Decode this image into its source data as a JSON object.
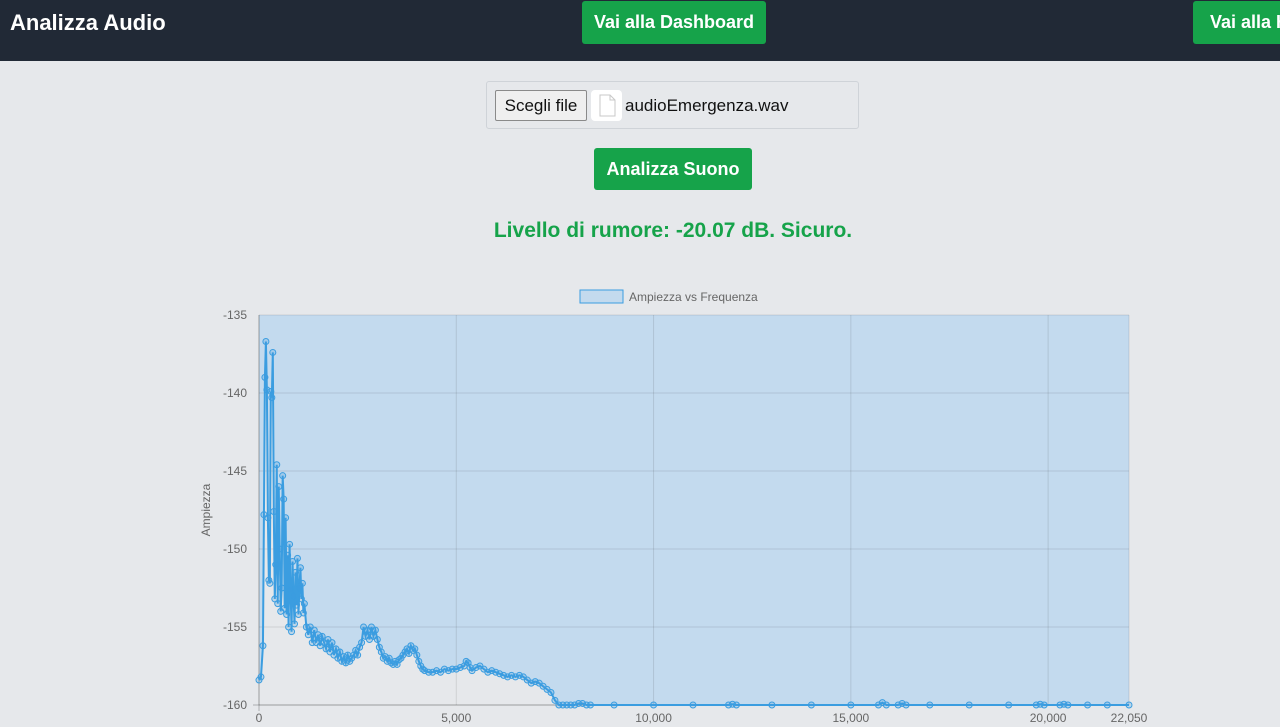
{
  "header": {
    "title": "Analizza Audio",
    "dashboard_button": "Vai alla Dashboard",
    "home_button": "Vai alla Home"
  },
  "upload": {
    "choose_button": "Scegli file",
    "file_name": "audioEmergenza.wav",
    "analyze_button": "Analizza Suono"
  },
  "result": {
    "text": "Livello di rumore: -20.07 dB. Sicuro."
  },
  "colors": {
    "accent": "#16a34a",
    "header_bg": "#212936",
    "line": "#3b9de0",
    "fill": "#c3daee"
  },
  "chart_data": {
    "type": "line",
    "legend": "Ampiezza vs Frequenza",
    "ylabel": "Ampiezza",
    "xlabel": "",
    "xlim": [
      0,
      22050
    ],
    "ylim": [
      -160,
      -135
    ],
    "x_ticks": [
      "0",
      "5,000",
      "10,000",
      "15,000",
      "20,000",
      "22,050"
    ],
    "y_ticks": [
      "-135",
      "-140",
      "-145",
      "-150",
      "-155",
      "-160"
    ],
    "grid": true,
    "fill": "area",
    "points": [
      [
        0,
        -158.4
      ],
      [
        50,
        -158.2
      ],
      [
        100,
        -156.2
      ],
      [
        125,
        -147.8
      ],
      [
        150,
        -139.0
      ],
      [
        175,
        -136.7
      ],
      [
        200,
        -139.8
      ],
      [
        225,
        -148.0
      ],
      [
        250,
        -152.0
      ],
      [
        275,
        -152.2
      ],
      [
        300,
        -139.9
      ],
      [
        325,
        -140.3
      ],
      [
        350,
        -137.4
      ],
      [
        375,
        -147.6
      ],
      [
        400,
        -153.2
      ],
      [
        425,
        -151.0
      ],
      [
        450,
        -144.6
      ],
      [
        475,
        -153.5
      ],
      [
        500,
        -146.0
      ],
      [
        525,
        -150.0
      ],
      [
        550,
        -154.0
      ],
      [
        575,
        -152.5
      ],
      [
        600,
        -145.3
      ],
      [
        625,
        -146.8
      ],
      [
        650,
        -153.8
      ],
      [
        675,
        -148.0
      ],
      [
        700,
        -154.2
      ],
      [
        725,
        -150.4
      ],
      [
        750,
        -155.0
      ],
      [
        775,
        -149.7
      ],
      [
        800,
        -152.6
      ],
      [
        825,
        -155.3
      ],
      [
        850,
        -150.8
      ],
      [
        875,
        -153.0
      ],
      [
        900,
        -154.8
      ],
      [
        925,
        -151.5
      ],
      [
        950,
        -153.6
      ],
      [
        975,
        -150.6
      ],
      [
        1000,
        -154.2
      ],
      [
        1025,
        -152.5
      ],
      [
        1050,
        -151.2
      ],
      [
        1075,
        -153.2
      ],
      [
        1100,
        -152.2
      ],
      [
        1125,
        -154.1
      ],
      [
        1150,
        -153.5
      ],
      [
        1200,
        -155.0
      ],
      [
        1250,
        -155.5
      ],
      [
        1300,
        -155.0
      ],
      [
        1350,
        -156.0
      ],
      [
        1400,
        -155.2
      ],
      [
        1450,
        -156.0
      ],
      [
        1500,
        -155.5
      ],
      [
        1550,
        -156.2
      ],
      [
        1600,
        -155.6
      ],
      [
        1650,
        -156.0
      ],
      [
        1700,
        -156.4
      ],
      [
        1750,
        -155.8
      ],
      [
        1800,
        -156.6
      ],
      [
        1850,
        -156.0
      ],
      [
        1900,
        -156.8
      ],
      [
        1950,
        -156.4
      ],
      [
        2000,
        -157.0
      ],
      [
        2050,
        -156.6
      ],
      [
        2100,
        -157.2
      ],
      [
        2150,
        -156.9
      ],
      [
        2200,
        -157.3
      ],
      [
        2250,
        -156.8
      ],
      [
        2300,
        -157.2
      ],
      [
        2350,
        -157.0
      ],
      [
        2400,
        -156.8
      ],
      [
        2450,
        -156.5
      ],
      [
        2500,
        -156.8
      ],
      [
        2550,
        -156.3
      ],
      [
        2600,
        -156.0
      ],
      [
        2650,
        -155.0
      ],
      [
        2700,
        -155.6
      ],
      [
        2750,
        -155.2
      ],
      [
        2800,
        -155.8
      ],
      [
        2850,
        -155.0
      ],
      [
        2900,
        -155.6
      ],
      [
        2950,
        -155.2
      ],
      [
        3000,
        -155.8
      ],
      [
        3050,
        -156.3
      ],
      [
        3100,
        -156.6
      ],
      [
        3150,
        -157.0
      ],
      [
        3200,
        -156.9
      ],
      [
        3250,
        -157.2
      ],
      [
        3300,
        -157.0
      ],
      [
        3350,
        -157.3
      ],
      [
        3400,
        -157.4
      ],
      [
        3450,
        -157.2
      ],
      [
        3500,
        -157.4
      ],
      [
        3550,
        -157.1
      ],
      [
        3600,
        -157.0
      ],
      [
        3650,
        -156.8
      ],
      [
        3700,
        -156.6
      ],
      [
        3750,
        -156.4
      ],
      [
        3800,
        -156.7
      ],
      [
        3850,
        -156.2
      ],
      [
        3900,
        -156.5
      ],
      [
        3950,
        -156.4
      ],
      [
        4000,
        -156.8
      ],
      [
        4050,
        -157.2
      ],
      [
        4100,
        -157.5
      ],
      [
        4150,
        -157.7
      ],
      [
        4200,
        -157.8
      ],
      [
        4300,
        -157.9
      ],
      [
        4400,
        -157.9
      ],
      [
        4500,
        -157.8
      ],
      [
        4600,
        -157.9
      ],
      [
        4700,
        -157.7
      ],
      [
        4800,
        -157.8
      ],
      [
        4900,
        -157.7
      ],
      [
        5000,
        -157.7
      ],
      [
        5100,
        -157.6
      ],
      [
        5200,
        -157.5
      ],
      [
        5250,
        -157.2
      ],
      [
        5300,
        -157.3
      ],
      [
        5350,
        -157.6
      ],
      [
        5400,
        -157.8
      ],
      [
        5500,
        -157.6
      ],
      [
        5600,
        -157.5
      ],
      [
        5700,
        -157.7
      ],
      [
        5800,
        -157.9
      ],
      [
        5900,
        -157.8
      ],
      [
        6000,
        -157.9
      ],
      [
        6100,
        -158.0
      ],
      [
        6200,
        -158.1
      ],
      [
        6300,
        -158.2
      ],
      [
        6400,
        -158.1
      ],
      [
        6500,
        -158.2
      ],
      [
        6600,
        -158.1
      ],
      [
        6700,
        -158.2
      ],
      [
        6800,
        -158.4
      ],
      [
        6900,
        -158.6
      ],
      [
        7000,
        -158.5
      ],
      [
        7100,
        -158.6
      ],
      [
        7200,
        -158.8
      ],
      [
        7300,
        -159.0
      ],
      [
        7400,
        -159.2
      ],
      [
        7500,
        -159.7
      ],
      [
        7600,
        -160.0
      ],
      [
        7700,
        -160.0
      ],
      [
        7800,
        -160.0
      ],
      [
        7900,
        -160.0
      ],
      [
        8000,
        -160.0
      ],
      [
        8100,
        -159.9
      ],
      [
        8200,
        -159.9
      ],
      [
        8300,
        -160.0
      ],
      [
        8400,
        -160.0
      ],
      [
        9000,
        -160.0
      ],
      [
        10000,
        -160.0
      ],
      [
        11000,
        -160.0
      ],
      [
        11900,
        -160.0
      ],
      [
        12000,
        -159.95
      ],
      [
        12100,
        -160.0
      ],
      [
        13000,
        -160.0
      ],
      [
        14000,
        -160.0
      ],
      [
        15000,
        -160.0
      ],
      [
        15700,
        -160.0
      ],
      [
        15800,
        -159.85
      ],
      [
        15900,
        -160.0
      ],
      [
        16200,
        -160.0
      ],
      [
        16300,
        -159.9
      ],
      [
        16400,
        -160.0
      ],
      [
        17000,
        -160.0
      ],
      [
        18000,
        -160.0
      ],
      [
        19000,
        -160.0
      ],
      [
        19700,
        -160.0
      ],
      [
        19800,
        -159.95
      ],
      [
        19900,
        -160.0
      ],
      [
        20300,
        -160.0
      ],
      [
        20400,
        -159.95
      ],
      [
        20500,
        -160.0
      ],
      [
        21000,
        -160.0
      ],
      [
        21500,
        -160.0
      ],
      [
        22050,
        -160.0
      ]
    ]
  }
}
